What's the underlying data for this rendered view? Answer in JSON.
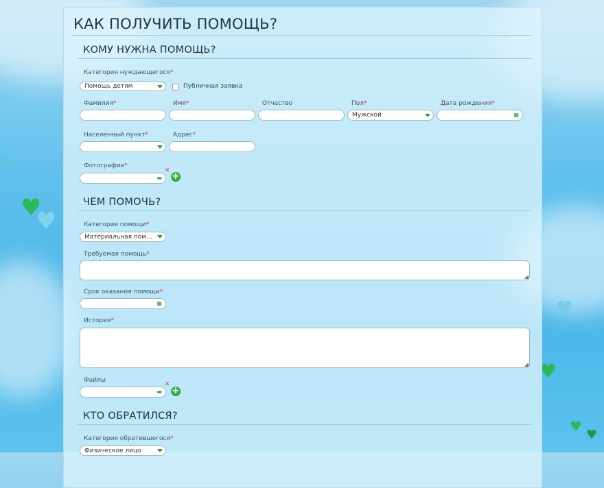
{
  "page": {
    "title": "КАК ПОЛУЧИТЬ ПОМОЩЬ?"
  },
  "colors": {
    "accent": "#2e9d3b",
    "required": "#d32f2f",
    "remove": "#e53935"
  },
  "icons": {
    "dropdown": "chevron-down-icon",
    "calendar": "calendar-icon",
    "folder": "folder-icon",
    "add": "plus-circle-icon",
    "remove": "close-icon",
    "resize": "resize-grip-icon"
  },
  "sections": {
    "who": {
      "title": "КОМУ НУЖНА ПОМОЩЬ?"
    },
    "what": {
      "title": "ЧЕМ ПОМОЧЬ?"
    },
    "applicant": {
      "title": "КТО ОБРАТИЛСЯ?"
    }
  },
  "fields": {
    "beneficiary_category": {
      "label": "Категория нуждающегося",
      "value": "Помощь детям"
    },
    "public_request": {
      "label": "Публичная заявка",
      "checked": false
    },
    "surname": {
      "label": "Фамилия",
      "value": ""
    },
    "name": {
      "label": "Имя",
      "value": ""
    },
    "patronymic": {
      "label": "Отчество",
      "value": ""
    },
    "gender": {
      "label": "Пол",
      "value": "Мужской"
    },
    "birth_date": {
      "label": "Дата рождения",
      "value": ""
    },
    "locality": {
      "label": "Населенный пункт",
      "value": ""
    },
    "address": {
      "label": "Адрес",
      "value": ""
    },
    "photos": {
      "label": "Фотографии",
      "value": ""
    },
    "help_category": {
      "label": "Категория помощи",
      "value": "Материальная пом..."
    },
    "required_help": {
      "label": "Требуемая помощь",
      "value": ""
    },
    "deadline": {
      "label": "Срок оказания помощи",
      "value": ""
    },
    "story": {
      "label": "История",
      "value": ""
    },
    "files": {
      "label": "Файлы",
      "value": ""
    },
    "applicant_category": {
      "label": "Категория обратившегося",
      "value": "Физическое лицо"
    }
  },
  "symbols": {
    "required": "*",
    "add": "+",
    "remove": "✕",
    "calendar": "▦",
    "folder": "▬",
    "resize": "◢"
  }
}
